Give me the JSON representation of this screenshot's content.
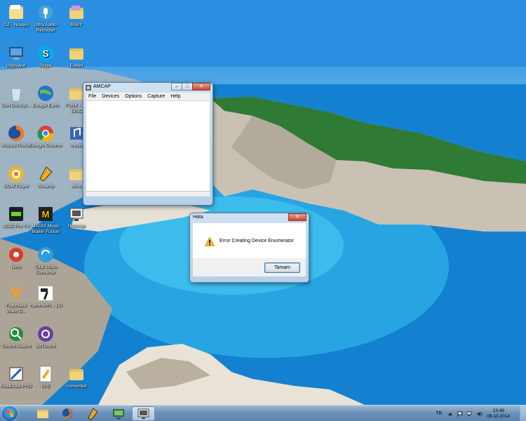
{
  "desktop": {
    "icons": [
      {
        "label": "GZ - Nisayol",
        "icon": "folder-icon"
      },
      {
        "label": "Ultra Audio Recorder",
        "icon": "audio-recorder-icon"
      },
      {
        "label": "BABY",
        "icon": "folder-icon"
      },
      {
        "label": "Bilgisayar",
        "icon": "computer-icon"
      },
      {
        "label": "Skype",
        "icon": "skype-icon"
      },
      {
        "label": "Edited",
        "icon": "folder-icon"
      },
      {
        "label": "Geri Dönüşü...",
        "icon": "recycle-bin-icon"
      },
      {
        "label": "Google Earth",
        "icon": "google-earth-icon"
      },
      {
        "label": "FUNK - S - DISC",
        "icon": "folder-icon"
      },
      {
        "label": "Mozilla Firefox",
        "icon": "firefox-icon"
      },
      {
        "label": "Google Chrome",
        "icon": "chrome-icon"
      },
      {
        "label": "music",
        "icon": "music-icon"
      },
      {
        "label": "GOM Player",
        "icon": "gom-player-icon"
      },
      {
        "label": "Winamp",
        "icon": "winamp-icon"
      },
      {
        "label": "drive",
        "icon": "folder-icon"
      },
      {
        "label": "ACID Pro 7.0",
        "icon": "acid-pro-icon"
      },
      {
        "label": "MAGIX Music Maker Fusion",
        "icon": "magix-icon"
      },
      {
        "label": "HAmcap",
        "icon": "amcap-icon"
      },
      {
        "label": "Nero",
        "icon": "nero-icon"
      },
      {
        "label": "Total Video Converter",
        "icon": "video-converter-icon"
      },
      {
        "label": "Freemake Video C...",
        "icon": "freemake-icon"
      },
      {
        "label": "HammerH... 1.0",
        "icon": "hammer-icon"
      },
      {
        "label": "Torrent Search",
        "icon": "torrent-search-icon"
      },
      {
        "label": "BitTorrent",
        "icon": "bittorrent-icon"
      },
      {
        "label": "RealDraw PRO",
        "icon": "realdraw-icon"
      },
      {
        "label": "SPE",
        "icon": "spe-icon"
      },
      {
        "label": "converted",
        "icon": "folder-icon"
      }
    ]
  },
  "amcap_window": {
    "title": "AMCAP",
    "menu": [
      "File",
      "Devices",
      "Options",
      "Capture",
      "Help"
    ],
    "controls": {
      "minimize": "–",
      "maximize": "□",
      "close": "✕"
    }
  },
  "error_dialog": {
    "title": "Hata",
    "message": "Error Creating Device Enumerator",
    "ok_label": "Tamam",
    "close": "✕"
  },
  "taskbar": {
    "pinned": [
      "explorer-icon",
      "firefox-icon",
      "winamp-icon",
      "monitor-app-icon",
      "amcap-icon"
    ],
    "language": "TR",
    "time": "23:49",
    "date": "08.10.2014"
  },
  "colors": {
    "sea": "#1b86d6",
    "titlebar": "#c3d7ec",
    "close_button": "#c74a32"
  }
}
